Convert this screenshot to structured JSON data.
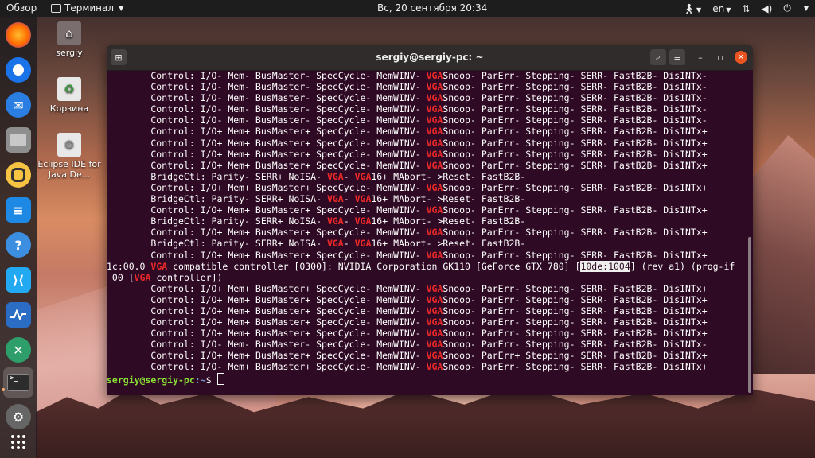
{
  "topbar": {
    "overview": "Обзор",
    "app_name": "Терминал",
    "clock": "Вс, 20 сентября  20:34",
    "lang": "en"
  },
  "desktop": {
    "icons": [
      {
        "label": "sergiy"
      },
      {
        "label": "Корзина"
      },
      {
        "label": "Eclipse IDE for Java De..."
      }
    ]
  },
  "terminal": {
    "title": "sergiy@sergiy-pc: ~",
    "lines": [
      "        Control: I/O- Mem- BusMaster- SpecCycle- MemWINV- VGASnoop- ParErr- Stepping- SERR- FastB2B- DisINTx-",
      "        Control: I/O- Mem- BusMaster- SpecCycle- MemWINV- VGASnoop- ParErr- Stepping- SERR- FastB2B- DisINTx-",
      "        Control: I/O- Mem- BusMaster- SpecCycle- MemWINV- VGASnoop- ParErr- Stepping- SERR- FastB2B- DisINTx-",
      "        Control: I/O- Mem- BusMaster- SpecCycle- MemWINV- VGASnoop- ParErr- Stepping- SERR- FastB2B- DisINTx-",
      "        Control: I/O- Mem- BusMaster- SpecCycle- MemWINV- VGASnoop- ParErr- Stepping- SERR- FastB2B- DisINTx-",
      "        Control: I/O+ Mem+ BusMaster+ SpecCycle- MemWINV- VGASnoop- ParErr- Stepping- SERR- FastB2B- DisINTx+",
      "        Control: I/O+ Mem+ BusMaster+ SpecCycle- MemWINV- VGASnoop- ParErr- Stepping- SERR- FastB2B- DisINTx+",
      "        Control: I/O+ Mem+ BusMaster+ SpecCycle- MemWINV- VGASnoop- ParErr- Stepping- SERR- FastB2B- DisINTx+",
      "        Control: I/O+ Mem+ BusMaster+ SpecCycle- MemWINV- VGASnoop- ParErr- Stepping- SERR- FastB2B- DisINTx+",
      "        BridgeCtl: Parity- SERR+ NoISA- VGA- VGA16+ MAbort- >Reset- FastB2B-",
      "        Control: I/O+ Mem+ BusMaster+ SpecCycle- MemWINV- VGASnoop- ParErr- Stepping- SERR- FastB2B- DisINTx+",
      "        BridgeCtl: Parity- SERR+ NoISA- VGA- VGA16+ MAbort- >Reset- FastB2B-",
      "        Control: I/O+ Mem+ BusMaster+ SpecCycle- MemWINV- VGASnoop- ParErr- Stepping- SERR- FastB2B- DisINTx+",
      "        BridgeCtl: Parity- SERR+ NoISA- VGA- VGA16+ MAbort- >Reset- FastB2B-",
      "        Control: I/O+ Mem+ BusMaster+ SpecCycle- MemWINV- VGASnoop- ParErr- Stepping- SERR- FastB2B- DisINTx+",
      "        BridgeCtl: Parity- SERR+ NoISA- VGA- VGA16+ MAbort- >Reset- FastB2B-",
      "        Control: I/O+ Mem+ BusMaster+ SpecCycle- MemWINV- VGASnoop- ParErr- Stepping- SERR- FastB2B- DisINTx+",
      "1c:00.0 VGA compatible controller [0300]: NVIDIA Corporation GK110 [GeForce GTX 780] [10de:1004] (rev a1) (prog-if",
      " 00 [VGA controller])",
      "        Control: I/O+ Mem+ BusMaster+ SpecCycle- MemWINV- VGASnoop- ParErr- Stepping- SERR- FastB2B- DisINTx+",
      "        Control: I/O+ Mem+ BusMaster+ SpecCycle- MemWINV- VGASnoop- ParErr- Stepping- SERR- FastB2B- DisINTx+",
      "        Control: I/O+ Mem+ BusMaster+ SpecCycle- MemWINV- VGASnoop- ParErr- Stepping- SERR- FastB2B- DisINTx+",
      "        Control: I/O+ Mem+ BusMaster+ SpecCycle- MemWINV- VGASnoop- ParErr- Stepping- SERR- FastB2B- DisINTx+",
      "        Control: I/O+ Mem+ BusMaster+ SpecCycle- MemWINV- VGASnoop- ParErr- Stepping- SERR- FastB2B- DisINTx+",
      "        Control: I/O- Mem- BusMaster- SpecCycle- MemWINV- VGASnoop- ParErr- Stepping- SERR- FastB2B- DisINTx-",
      "        Control: I/O+ Mem+ BusMaster+ SpecCycle- MemWINV- VGASnoop- ParErr+ Stepping- SERR- FastB2B- DisINTx+",
      "        Control: I/O- Mem+ BusMaster+ SpecCycle- MemWINV- VGASnoop- ParErr- Stepping- SERR- FastB2B- DisINTx+"
    ],
    "highlight_word": "VGA",
    "selected_text": "10de:1004",
    "prompt_user": "sergiy@sergiy-pc",
    "prompt_path": ":~",
    "prompt_symbol": "$ "
  },
  "colors": {
    "terminal_bg": "#2f0a24",
    "highlight": "#ef2929",
    "prompt_user": "#8ae234",
    "prompt_path": "#729fcf",
    "close_button": "#e95420"
  }
}
